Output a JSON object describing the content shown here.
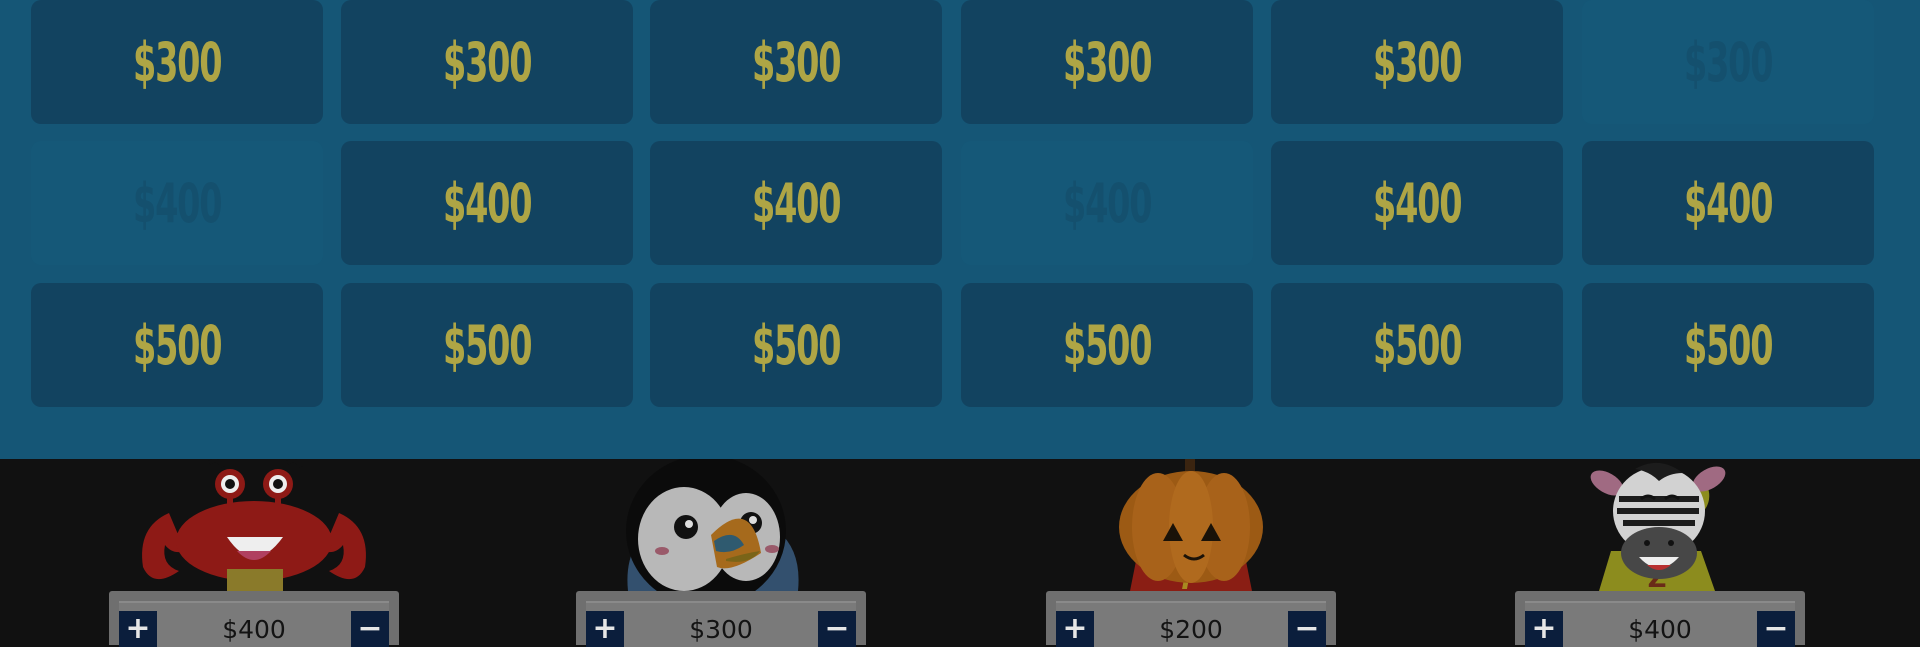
{
  "board": {
    "rows": [
      {
        "value": "$300",
        "tiles": [
          {
            "label": "$300",
            "used": false
          },
          {
            "label": "$300",
            "used": false
          },
          {
            "label": "$300",
            "used": false
          },
          {
            "label": "$300",
            "used": false
          },
          {
            "label": "$300",
            "used": false
          },
          {
            "label": "$300",
            "used": true
          }
        ]
      },
      {
        "value": "$400",
        "tiles": [
          {
            "label": "$400",
            "used": true
          },
          {
            "label": "$400",
            "used": false
          },
          {
            "label": "$400",
            "used": false
          },
          {
            "label": "$400",
            "used": true
          },
          {
            "label": "$400",
            "used": false
          },
          {
            "label": "$400",
            "used": false
          }
        ]
      },
      {
        "value": "$500",
        "tiles": [
          {
            "label": "$500",
            "used": false
          },
          {
            "label": "$500",
            "used": false
          },
          {
            "label": "$500",
            "used": false
          },
          {
            "label": "$500",
            "used": false
          },
          {
            "label": "$500",
            "used": false
          },
          {
            "label": "$500",
            "used": false
          }
        ]
      }
    ]
  },
  "players": [
    {
      "avatar": "crab-avatar",
      "score": "$400",
      "plus_label": "+",
      "minus_label": "−"
    },
    {
      "avatar": "puffin-avatar",
      "score": "$300",
      "plus_label": "+",
      "minus_label": "−"
    },
    {
      "avatar": "pumpkin-avatar",
      "score": "$200",
      "plus_label": "+",
      "minus_label": "−"
    },
    {
      "avatar": "zebra-avatar",
      "score": "$400",
      "plus_label": "+",
      "minus_label": "−"
    }
  ],
  "colors": {
    "board_bg": "#155676",
    "tile_bg": "#124360",
    "tile_text": "#aea545",
    "stage_bg": "#111111",
    "button_bg": "#0b1e3c"
  }
}
